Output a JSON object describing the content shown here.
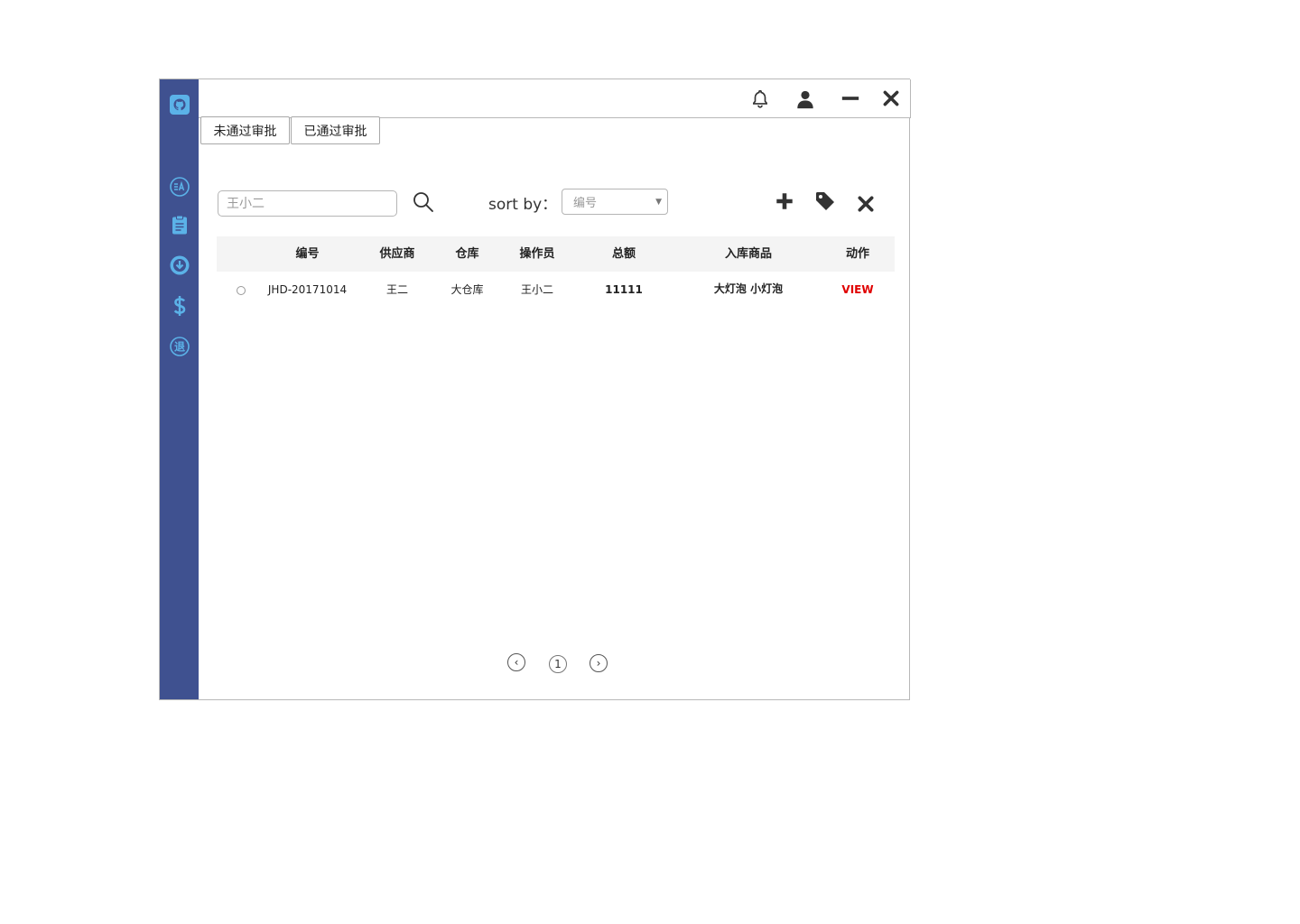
{
  "sidebar": {
    "items": [
      {
        "icon": "github-icon"
      },
      {
        "icon": "vendor-icon"
      },
      {
        "icon": "clipboard-icon"
      },
      {
        "icon": "download-circle-icon"
      },
      {
        "icon": "dollar-icon"
      },
      {
        "icon": "return-icon",
        "glyph": "退"
      }
    ]
  },
  "titlebar": {
    "icons": [
      "bell-icon",
      "user-icon",
      "minimize-icon",
      "close-icon"
    ]
  },
  "tabs": [
    {
      "label": "未通过审批"
    },
    {
      "label": "已通过审批"
    }
  ],
  "toolbar": {
    "search_placeholder": "王小二",
    "sort_label": "sort by：",
    "sort_value": "编号",
    "actions": [
      "add-icon",
      "tag-icon",
      "delete-icon"
    ]
  },
  "table": {
    "columns": [
      "编号",
      "供应商",
      "仓库",
      "操作员",
      "总额",
      "入库商品",
      "动作"
    ],
    "rows": [
      {
        "id": "JHD-20171014",
        "supplier": "王二",
        "warehouse": "大仓库",
        "operator": "王小二",
        "total": "11111",
        "goods": "大灯泡 小灯泡",
        "action": "VIEW"
      }
    ]
  },
  "pager": {
    "prev": "‹",
    "current": "1",
    "next": "›"
  },
  "colors": {
    "sidebar_bg": "#3f5190",
    "sidebar_icon": "#5bb2e8",
    "view_link": "#e00000"
  }
}
